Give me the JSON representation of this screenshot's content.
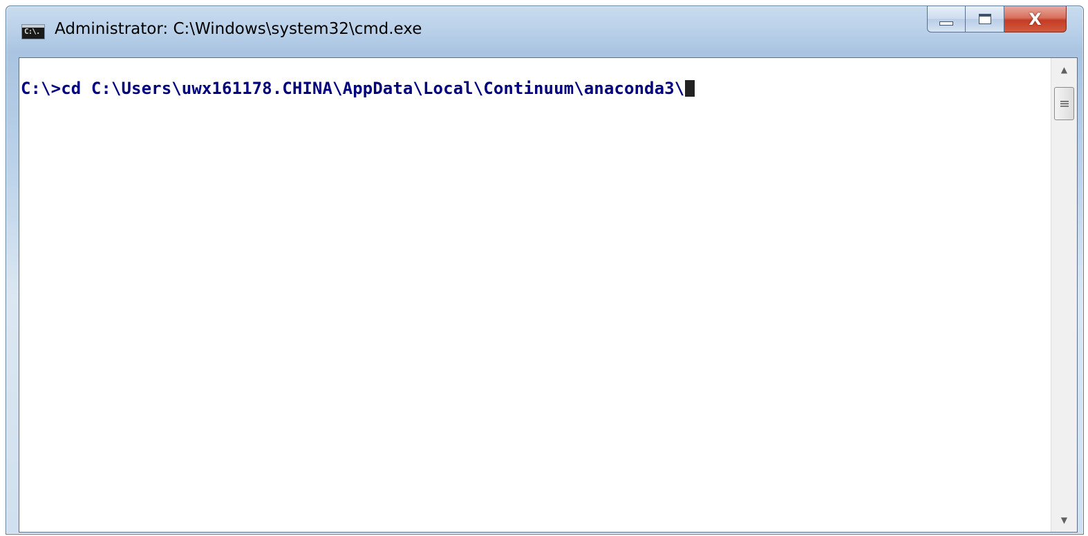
{
  "window": {
    "title": "Administrator: C:\\Windows\\system32\\cmd.exe",
    "icon": "cmd-console-icon",
    "icon_text": "C:\\."
  },
  "caption_buttons": {
    "minimize": "minimize-icon",
    "maximize": "maximize-icon",
    "close": "close-icon",
    "close_glyph": "X"
  },
  "console": {
    "lines": [
      "C:\\>cd C:\\Users\\uwx161178.CHINA\\AppData\\Local\\Continuum\\anaconda3\\"
    ],
    "text_color": "#00007f",
    "background": "#ffffff"
  },
  "scrollbar": {
    "up_glyph": "▲",
    "down_glyph": "▼"
  }
}
